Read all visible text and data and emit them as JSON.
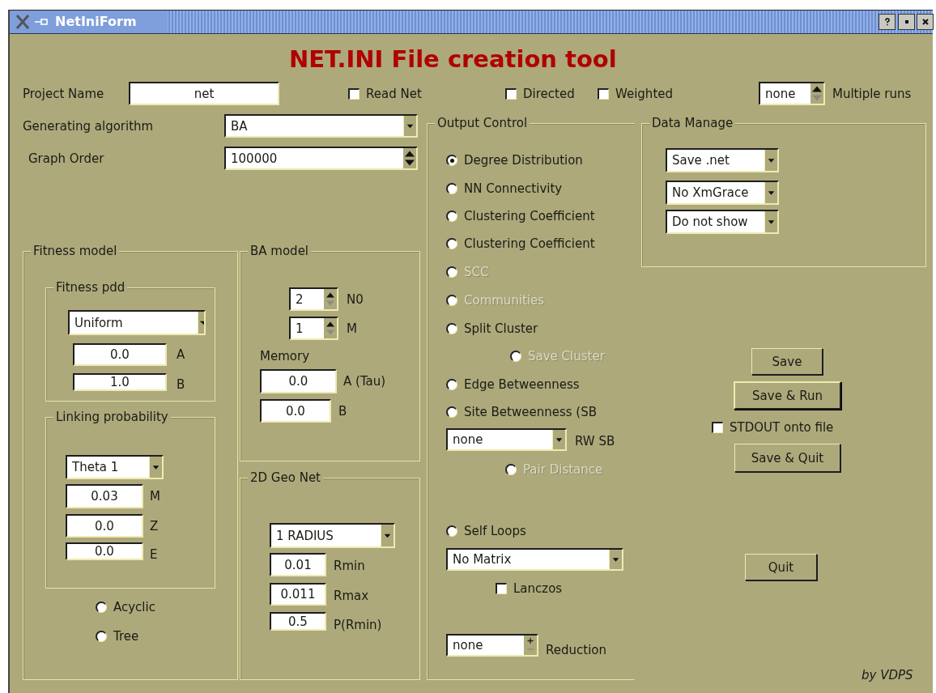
{
  "window": {
    "title": "NetIniForm"
  },
  "heading": "NET.INI File creation tool",
  "project_name": {
    "label": "Project Name",
    "value": "net"
  },
  "flags": [
    {
      "label": "Read Net",
      "checked": false
    },
    {
      "label": "Directed",
      "checked": false
    },
    {
      "label": "Weighted",
      "checked": false
    }
  ],
  "multiple_runs": {
    "value": "none",
    "label": "Multiple runs"
  },
  "generating_algorithm": {
    "label": "Generating algorithm",
    "value": "BA"
  },
  "graph_order": {
    "label": "Graph Order",
    "value": "100000"
  },
  "fitness_model": {
    "title": "Fitness model",
    "fitness_pdd": {
      "title": "Fitness pdd",
      "distribution": "Uniform",
      "fields": [
        {
          "value": "0.0",
          "label": "A"
        },
        {
          "value": "1.0",
          "label": "B"
        }
      ]
    },
    "linking_probability": {
      "title": "Linking probability",
      "function": "Theta 1",
      "fields": [
        {
          "value": "0.03",
          "label": "M"
        },
        {
          "value": "0.0",
          "label": "Z"
        },
        {
          "value": "0.0",
          "label": "E"
        }
      ]
    },
    "options": [
      {
        "label": "Acyclic",
        "selected": false
      },
      {
        "label": "Tree",
        "selected": false
      }
    ]
  },
  "ba_model": {
    "title": "BA model",
    "spins": [
      {
        "value": "2",
        "label": "N0"
      },
      {
        "value": "1",
        "label": "M"
      }
    ],
    "memory_label": "Memory",
    "fields": [
      {
        "value": "0.0",
        "label": "A (Tau)"
      },
      {
        "value": "0.0",
        "label": "B"
      }
    ]
  },
  "geo_net": {
    "title": "2D Geo Net",
    "mode": "1 RADIUS",
    "fields": [
      {
        "value": "0.01",
        "label": "Rmin"
      },
      {
        "value": "0.011",
        "label": "Rmax"
      },
      {
        "value": "0.5",
        "label": "P(Rmin)"
      }
    ]
  },
  "output_control": {
    "title": "Output Control",
    "items": [
      {
        "kind": "radio",
        "label": "Degree Distribution",
        "selected": true,
        "disabled": false
      },
      {
        "kind": "radio",
        "label": "NN Connectivity",
        "selected": false,
        "disabled": false
      },
      {
        "kind": "radio",
        "label": "Clustering Coefficient",
        "selected": false,
        "disabled": false
      },
      {
        "kind": "radio",
        "label": "Clustering Coefficient",
        "selected": false,
        "disabled": false
      },
      {
        "kind": "radio",
        "label": "SCC",
        "selected": false,
        "disabled": true
      },
      {
        "kind": "radio",
        "label": "Communities",
        "selected": false,
        "disabled": true
      },
      {
        "kind": "radio",
        "label": "Split Cluster",
        "selected": false,
        "disabled": false
      },
      {
        "kind": "radio",
        "label": "Save Cluster",
        "selected": false,
        "disabled": true
      },
      {
        "kind": "radio",
        "label": "Edge Betweenness",
        "selected": false,
        "disabled": false
      },
      {
        "kind": "radio",
        "label": "Site Betweenness (SB",
        "selected": false,
        "disabled": false,
        "walk": {
          "value": "none",
          "label": "RW SB"
        }
      },
      {
        "kind": "radio",
        "label": "Pair Distance",
        "selected": false,
        "disabled": true
      },
      {
        "kind": "radio",
        "label": "Self Loops",
        "selected": false,
        "disabled": false
      },
      {
        "kind": "select",
        "value": "No Matrix"
      },
      {
        "kind": "checkbox",
        "label": "Lanczos",
        "checked": false
      },
      {
        "kind": "spin",
        "value": "none",
        "label": "Reduction"
      }
    ]
  },
  "data_manage": {
    "title": "Data Manage",
    "selects": [
      "Save .net",
      "No XmGrace",
      "Do not show"
    ]
  },
  "actions": [
    {
      "kind": "button",
      "label": "Save",
      "default": false
    },
    {
      "kind": "button",
      "label": "Save & Run",
      "default": true
    },
    {
      "kind": "checkbox",
      "label": "STDOUT onto file",
      "checked": false
    },
    {
      "kind": "button",
      "label": "Save & Quit",
      "default": false
    },
    {
      "kind": "button",
      "label": "Quit",
      "default": false
    }
  ],
  "credit": "by VDPS"
}
